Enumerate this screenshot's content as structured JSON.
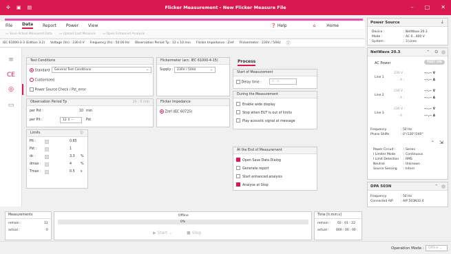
{
  "window": {
    "title": "Flicker Measurement - New Flicker Measure File"
  },
  "menu": {
    "items": [
      "File",
      "Data",
      "Report",
      "Power",
      "View"
    ],
    "active": "Data",
    "help": "Help",
    "home": "Home"
  },
  "toolbar": {
    "save": "Save Actual Measured Data",
    "upload": "Upload Last Measure",
    "open": "Open Enhanced Analysis"
  },
  "info": {
    "standard": "IEC 61000-3-3 (Edition 3.2)",
    "voltage": "Voltage (Vn) : 230.0 V",
    "frequency": "Frequency (fn) : 50.00 Hz",
    "period": "Observation Period Tp : 12 x 10 min",
    "impedance": "Flicker Impedance : Zref",
    "flickermeter": "Flickermeter : 230V / 50Hz"
  },
  "tests": {
    "header": "Test Conditions",
    "standard_label": "Standard",
    "standard_value": "General Test Conditions",
    "customized": "Customized",
    "power_check": "Power Source Check / Pst_error"
  },
  "flickermeter": {
    "header": "Flickermeter (acc. IEC 61000-4-15)",
    "supply_label": "Supply :",
    "supply_value": "230V / 50Hz"
  },
  "observation": {
    "header": "Observation Period Tp",
    "duration": "2h : 0 min",
    "per_pst_label": "per Pst :",
    "per_pst_value": "10",
    "per_pst_unit": "min",
    "per_plt_label": "per Plt :",
    "per_plt_value": "12",
    "per_plt_unit": "Pst"
  },
  "impedance": {
    "header": "Flicker Impedance",
    "value": "Zref (IEC 60725)"
  },
  "limits": {
    "header": "Limits",
    "rows": [
      {
        "label": "Plt :",
        "value": "0.65",
        "unit": ""
      },
      {
        "label": "Pst :",
        "value": "1",
        "unit": ""
      },
      {
        "label": "dc :",
        "value": "3.3",
        "unit": "%"
      },
      {
        "label": "dmax :",
        "value": "4",
        "unit": "%"
      },
      {
        "label": "Tmax :",
        "value": "0.5",
        "unit": "s"
      }
    ]
  },
  "process": {
    "title": "Process",
    "start_header": "Start of Measurement",
    "delay_label": "Delay time :",
    "delay_value": "0 : 0",
    "during_header": "During the Measurement",
    "during": [
      {
        "label": "Enable wide display",
        "checked": false
      },
      {
        "label": "Stop when EUT is out of limits",
        "checked": false
      },
      {
        "label": "Play acoustic signal at message",
        "checked": false
      }
    ],
    "end_header": "At the End of Measurement",
    "end": [
      {
        "label": "Open Save Data Dialog",
        "checked": true
      },
      {
        "label": "Generate report",
        "checked": false
      },
      {
        "label": "Start enhanced analysis",
        "checked": false
      },
      {
        "label": "Analyse at Stop",
        "checked": true
      }
    ]
  },
  "measurements": {
    "header": "Measurements",
    "remain_label": "remain :",
    "remain_value": "12",
    "actual_label": "actual :",
    "actual_value": "0"
  },
  "status": {
    "state": "Offline",
    "progress": "0%",
    "start": "Start",
    "stop": "Stop"
  },
  "time": {
    "header": "Time [h:min:s]",
    "remain_label": "remain :",
    "remain_value": "02 : 01 : 22",
    "actual_label": "actual :",
    "actual_value": "000 : 00 : 00"
  },
  "power_source": {
    "title": "Power Source",
    "device_label": "Device :",
    "device_value": ": NetWave 20.3",
    "mode_label": "Mode :",
    "mode_value": ": AC 0...400 V",
    "system_label": "System :",
    "system_value": ": 3 Lines"
  },
  "netwave": {
    "title": "NetWave 20.3",
    "ac_power": "AC Power",
    "test_on": "TEST ON",
    "lines": [
      {
        "name": "Line 1",
        "v": "230 V :",
        "a": "- A :",
        "vval": "---.-- V",
        "aval": "---.-- A"
      },
      {
        "name": "Line 2",
        "v": "230 V :",
        "a": "- A :",
        "vval": "---.-- V",
        "aval": "---.-- A"
      },
      {
        "name": "Line 3",
        "v": "230 V :",
        "a": "- A :",
        "vval": "---.-- V",
        "aval": "---.-- A"
      }
    ],
    "frequency_label": "Frequency",
    "frequency_value": ": 50 Hz",
    "phase_label": "Phase Shifts",
    "phase_value": ": 0°/120°/240°",
    "details": [
      {
        "k": "Power Circuit :",
        "v": ": Series"
      },
      {
        "k": "I Limiter Mode",
        "v": ": Continuous"
      },
      {
        "k": "I Limit Detection",
        "v": ": RMS"
      },
      {
        "k": "Neutral",
        "v": ": Unknown"
      },
      {
        "k": "Source Sensing",
        "v": ": Intern"
      }
    ]
  },
  "dpa": {
    "title": "DPA 503N",
    "freq_label": "Frequency",
    "freq_value": ": 50 Hz",
    "aip_label": "Connected AIP",
    "aip_value": ": AIP 503N32.4"
  },
  "footer": {
    "mode_label": "Operation Mode :",
    "mode_value": "Offline"
  }
}
